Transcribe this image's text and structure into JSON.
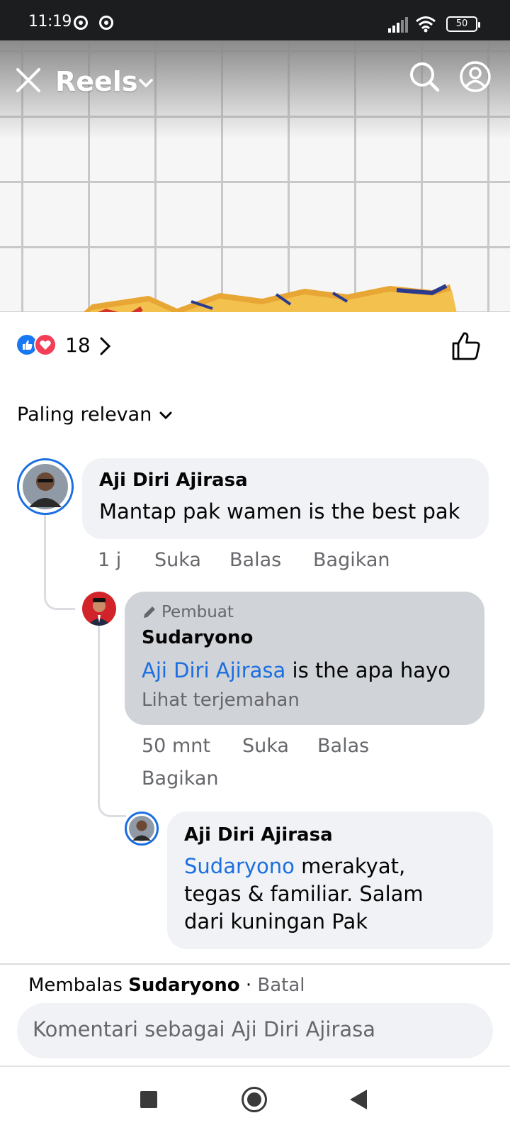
{
  "status_bar": {
    "time": "11:19",
    "battery": "50"
  },
  "reels_header": {
    "title": "Reels",
    "icons": [
      "close-icon",
      "chevron-down-icon",
      "search-icon",
      "profile-icon"
    ]
  },
  "reactions": {
    "count": "18",
    "icons": [
      "like-reaction-icon",
      "love-reaction-icon"
    ]
  },
  "sort": {
    "label": "Paling relevan"
  },
  "comments": [
    {
      "name": "Aji Diri Ajirasa",
      "text": "Mantap pak wamen is the best pak",
      "time": "1 j",
      "like": "Suka",
      "reply": "Balas",
      "share": "Bagikan"
    },
    {
      "badge": "Pembuat",
      "name": "Sudaryono",
      "mention": "Aji Diri Ajirasa",
      "text": " is the apa hayo",
      "translate": "Lihat terjemahan",
      "time": "50 mnt",
      "like": "Suka",
      "reply": "Balas",
      "share": "Bagikan"
    },
    {
      "name": "Aji Diri Ajirasa",
      "mention": "Sudaryono",
      "text_line1": " merakyat,",
      "text_line2": "tegas & familiar. Salam",
      "text_line3": "dari kuningan Pak"
    }
  ],
  "composer": {
    "replying_prefix": "Membalas",
    "replying_to": "Sudaryono",
    "separator": " · ",
    "cancel": "Batal",
    "placeholder": "Komentari sebagai Aji Diri Ajirasa"
  },
  "colors": {
    "accent": "#1b6fe0",
    "like_blue": "#1877f2",
    "love_red": "#f33e58",
    "bubble": "#f0f2f5",
    "author_bubble": "#d0d3d8"
  }
}
